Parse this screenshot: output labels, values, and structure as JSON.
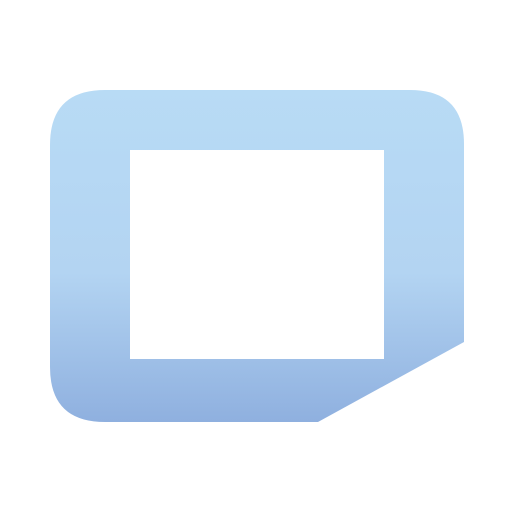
{
  "icon": {
    "name": "note-frame-icon",
    "colors": {
      "gradient_top": "#b8dbf5",
      "gradient_mid": "#b3d4f2",
      "gradient_bottom": "#8fb0df",
      "inner": "#ffffff",
      "background": "#ffffff"
    }
  }
}
